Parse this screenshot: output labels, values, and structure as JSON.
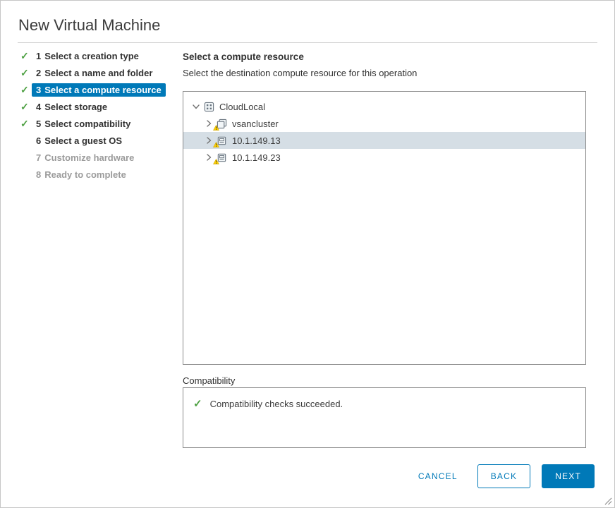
{
  "title": "New Virtual Machine",
  "icons": {
    "check": "✓"
  },
  "steps": [
    {
      "num": "1",
      "label": "Select a creation type",
      "state": "done"
    },
    {
      "num": "2",
      "label": "Select a name and folder",
      "state": "done"
    },
    {
      "num": "3",
      "label": "Select a compute resource",
      "state": "current"
    },
    {
      "num": "4",
      "label": "Select storage",
      "state": "done"
    },
    {
      "num": "5",
      "label": "Select compatibility",
      "state": "done"
    },
    {
      "num": "6",
      "label": "Select a guest OS",
      "state": "visited"
    },
    {
      "num": "7",
      "label": "Customize hardware",
      "state": "future"
    },
    {
      "num": "8",
      "label": "Ready to complete",
      "state": "future"
    }
  ],
  "main": {
    "heading": "Select a compute resource",
    "subheading": "Select the destination compute resource for this operation"
  },
  "tree": {
    "rows": [
      {
        "label": "CloudLocal",
        "type": "datacenter",
        "expanded": true,
        "selected": false,
        "warning": false
      },
      {
        "label": "vsancluster",
        "type": "cluster",
        "expanded": false,
        "selected": false,
        "warning": true
      },
      {
        "label": "10.1.149.13",
        "type": "host",
        "expanded": false,
        "selected": true,
        "warning": true
      },
      {
        "label": "10.1.149.23",
        "type": "host",
        "expanded": false,
        "selected": false,
        "warning": true
      }
    ]
  },
  "compatibility": {
    "label": "Compatibility",
    "message": "Compatibility checks succeeded."
  },
  "buttons": {
    "cancel": "CANCEL",
    "back": "BACK",
    "next": "NEXT"
  },
  "colors": {
    "accent": "#0079b8",
    "success": "#4fa144",
    "warning": "#fdd008",
    "selected_row": "#d5dee5"
  }
}
